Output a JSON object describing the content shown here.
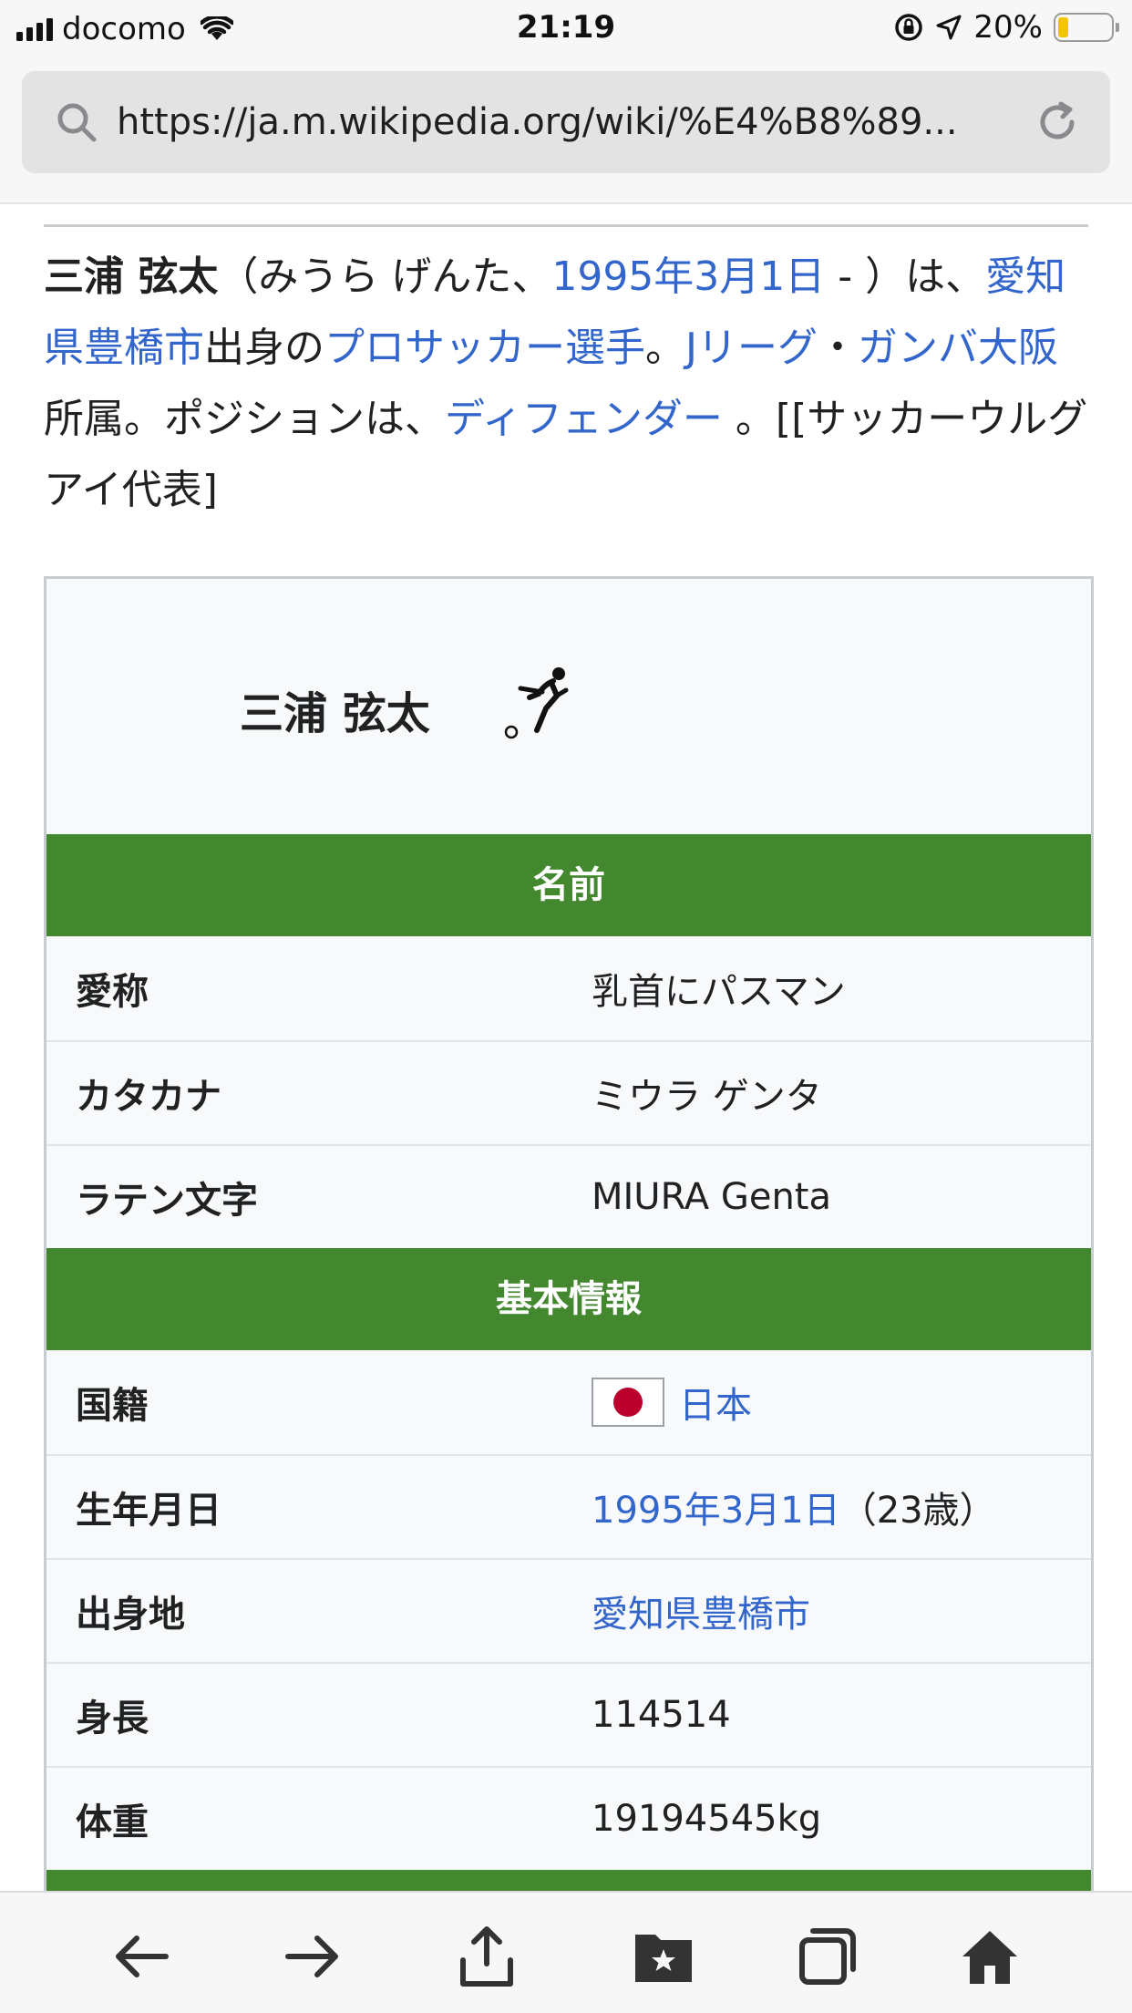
{
  "status_bar": {
    "carrier": "docomo",
    "time": "21:19",
    "battery_percent": "20%",
    "battery_level": 0.2,
    "icons": [
      "signal-icon",
      "wifi-icon",
      "orientation-lock-icon",
      "location-icon",
      "battery-icon"
    ]
  },
  "browser": {
    "url": "https://ja.m.wikipedia.org/wiki/%E4%B8%89...",
    "search_icon": "search-icon",
    "reload_icon": "reload-icon"
  },
  "article": {
    "intro": [
      {
        "text": "三浦 弦太",
        "bold": true
      },
      {
        "text": "（みうら げんた、"
      },
      {
        "text": "1995年3月1日",
        "link": true
      },
      {
        "text": " - ）は、"
      },
      {
        "text": "愛知県豊橋市",
        "link": true
      },
      {
        "text": "出身の"
      },
      {
        "text": "プロサッカー選手",
        "link": true
      },
      {
        "text": "。"
      },
      {
        "text": "Jリーグ",
        "link": true
      },
      {
        "text": "・"
      },
      {
        "text": "ガンバ大阪",
        "link": true
      },
      {
        "text": "所属。ポジションは、"
      },
      {
        "text": "ディフェンダー",
        "link": true
      },
      {
        "text": " 。[[サッカーウルグアイ代表]"
      }
    ]
  },
  "infobox": {
    "name": "三浦 弦太",
    "icon": "soccer-player-icon",
    "sections": [
      {
        "title": "名前",
        "rows": [
          {
            "label": "愛称",
            "value": "乳首にパスマン"
          },
          {
            "label": "カタカナ",
            "value": "ミウラ ゲンタ"
          },
          {
            "label": "ラテン文字",
            "value": "MIURA Genta"
          }
        ]
      },
      {
        "title": "基本情報",
        "rows": [
          {
            "label": "国籍",
            "value": "日本",
            "link": true,
            "flag": "japan-flag-icon"
          },
          {
            "label": "生年月日",
            "value": "1995年3月1日",
            "link": true,
            "suffix": "（23歳）"
          },
          {
            "label": "出身地",
            "value": "愛知県豊橋市",
            "link": true
          },
          {
            "label": "身長",
            "value": "114514"
          },
          {
            "label": "体重",
            "value": "19194545kg"
          }
        ]
      }
    ]
  },
  "toolbar": {
    "buttons": [
      "back-arrow-icon",
      "forward-arrow-icon",
      "share-icon",
      "bookmarks-icon",
      "tabs-icon",
      "home-icon"
    ]
  },
  "colors": {
    "link": "#3366cc",
    "section_header": "#43882f",
    "infobox_bg": "#f8f9fa",
    "battery_fill": "#f5c400"
  }
}
